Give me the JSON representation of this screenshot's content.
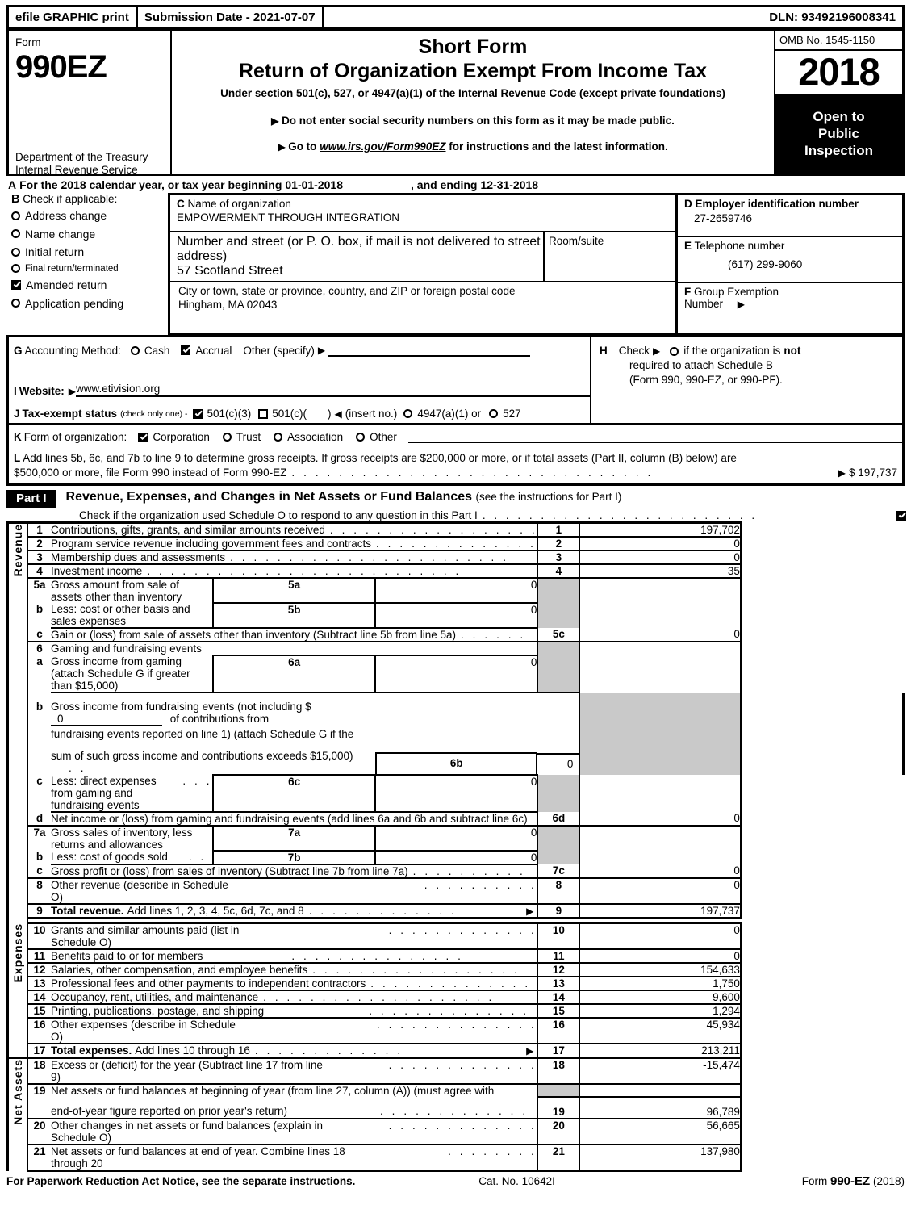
{
  "efile": {
    "graphic_print": "efile GRAPHIC print",
    "submission_date": "Submission Date - 2021-07-07",
    "dln": "DLN: 93492196008341"
  },
  "header": {
    "form_word": "Form",
    "form_number": "990EZ",
    "department": "Department of the Treasury Internal Revenue Service",
    "short_form": "Short Form",
    "title": "Return of Organization Exempt From Income Tax",
    "subtitle": "Under section 501(c), 527, or 4947(a)(1) of the Internal Revenue Code (except private foundations)",
    "bullet1": "Do not enter social security numbers on this form as it may be made public.",
    "bullet2_pre": "Go to",
    "bullet2_link": "www.irs.gov/Form990EZ",
    "bullet2_post": "for instructions and the latest information.",
    "omb": "OMB No. 1545-1150",
    "year": "2018",
    "open_to": "Open to",
    "public": "Public",
    "inspection": "Inspection"
  },
  "lineA": {
    "letter": "A",
    "text": "For the 2018 calendar year, or tax year beginning",
    "begin_date": "01-01-2018",
    "ending_label": ", and ending",
    "end_date": "12-31-2018"
  },
  "sectionB": {
    "letter": "B",
    "heading": "Check if applicable:",
    "items": [
      {
        "label": "Address change",
        "checked": false
      },
      {
        "label": "Name change",
        "checked": false
      },
      {
        "label": "Initial return",
        "checked": false
      },
      {
        "label": "Final return/terminated",
        "checked": false
      },
      {
        "label": "Amended return",
        "checked": true
      },
      {
        "label": "Application pending",
        "checked": false
      }
    ]
  },
  "sectionC": {
    "letter": "C",
    "name_label": "Name of organization",
    "org_name": "EMPOWERMENT THROUGH INTEGRATION",
    "street_label": "Number and street (or P. O. box, if mail is not delivered to street address)",
    "street": "57 Scotland Street",
    "room_label": "Room/suite",
    "room": "",
    "city_label": "City or town, state or province, country, and ZIP or foreign postal code",
    "city": "Hingham, MA   02043"
  },
  "sectionD": {
    "letter": "D",
    "ein_label": "Employer identification number",
    "ein": "27-2659746",
    "phone_letter": "E",
    "phone_label": "Telephone number",
    "phone": "(617) 299-9060",
    "group_letter": "F",
    "group_label1": "Group Exemption",
    "group_label2": "Number",
    "group_number": ""
  },
  "sectionG": {
    "letter": "G",
    "label": "Accounting Method:",
    "cash": "Cash",
    "cash_checked": false,
    "accrual": "Accrual",
    "accrual_checked": true,
    "other": "Other (specify)"
  },
  "sectionH": {
    "letter": "H",
    "line1a": "Check",
    "line1b": "if the organization is",
    "not_word": "not",
    "line2": "required to attach Schedule B",
    "line3": "(Form 990, 990-EZ, or 990-PF)."
  },
  "sectionI": {
    "letter": "I",
    "label": "Website:",
    "website": "www.etivision.org"
  },
  "sectionJ": {
    "letter": "J",
    "label": "Tax-exempt status",
    "note": "(check only one) -",
    "opt1": "501(c)(3)",
    "opt1_checked": true,
    "opt2": "501(c)(",
    "opt2_checked": false,
    "opt2_suffix": ")",
    "insert_no": "(insert no.)",
    "opt3": "4947(a)(1) or",
    "opt3_checked": false,
    "opt4": "527",
    "opt4_checked": false
  },
  "sectionK": {
    "letter": "K",
    "label": "Form of organization:",
    "options": [
      {
        "label": "Corporation",
        "checked": true
      },
      {
        "label": "Trust",
        "checked": false
      },
      {
        "label": "Association",
        "checked": false
      },
      {
        "label": "Other",
        "checked": false
      }
    ]
  },
  "sectionL": {
    "letter": "L",
    "text1": "Add lines 5b, 6c, and 7b to line 9 to determine gross receipts. If gross receipts are $200,000 or more, or if total assets (Part II, column (B) below) are",
    "text2": "$500,000 or more, file Form 990 instead of Form 990-EZ",
    "amount": "$ 197,737"
  },
  "partI": {
    "part_label": "Part I",
    "title": "Revenue, Expenses, and Changes in Net Assets or Fund Balances",
    "title_note": "(see the instructions for Part I)",
    "schedule_o": "Check if the organization used Schedule O to respond to any question in this Part I",
    "schedule_o_checked": true
  },
  "side_labels": {
    "revenue": "Revenue",
    "expenses": "Expenses",
    "net_assets": "Net Assets"
  },
  "revenue_lines": [
    {
      "n": "1",
      "desc": "Contributions, gifts, grants, and similar amounts received",
      "lnbox": "1",
      "amount": "197,702"
    },
    {
      "n": "2",
      "desc": "Program service revenue including government fees and contracts",
      "lnbox": "2",
      "amount": "0"
    },
    {
      "n": "3",
      "desc": "Membership dues and assessments",
      "lnbox": "3",
      "amount": "0"
    },
    {
      "n": "4",
      "desc": "Investment income",
      "lnbox": "4",
      "amount": "35"
    },
    {
      "n": "5a",
      "desc": "Gross amount from sale of assets other than inventory",
      "subbox": "5a",
      "subval": "0"
    },
    {
      "n": "b",
      "desc": "Less: cost or other basis and sales expenses",
      "subbox": "5b",
      "subval": "0"
    },
    {
      "n": "c",
      "desc": "Gain or (loss) from sale of assets other than inventory (Subtract line 5b from line 5a)",
      "lnbox": "5c",
      "amount": "0"
    },
    {
      "n": "6",
      "desc": "Gaming and fundraising events"
    },
    {
      "n": "a",
      "desc": "Gross income from gaming (attach Schedule G if greater than $15,000)",
      "subbox": "6a",
      "subval": "0"
    },
    {
      "n": "b",
      "desc_p1": "Gross income from fundraising events (not including $",
      "inline_value": "0",
      "desc_p2": "of contributions from",
      "desc_l2": "fundraising events reported on line 1) (attach Schedule G if the",
      "desc_l3": "sum of such gross income and contributions exceeds $15,000)",
      "subbox": "6b",
      "subval": "0"
    },
    {
      "n": "c",
      "desc": "Less: direct expenses from gaming and fundraising events",
      "subbox": "6c",
      "subval": "0"
    },
    {
      "n": "d",
      "desc": "Net income or (loss) from gaming and fundraising events (add lines 6a and 6b and subtract line 6c)",
      "lnbox": "6d",
      "amount": "0"
    },
    {
      "n": "7a",
      "desc": "Gross sales of inventory, less returns and allowances",
      "subbox": "7a",
      "subval": "0"
    },
    {
      "n": "b",
      "desc": "Less: cost of goods sold",
      "subbox": "7b",
      "subval": "0"
    },
    {
      "n": "c",
      "desc": "Gross profit or (loss) from sales of inventory (Subtract line 7b from line 7a)",
      "lnbox": "7c",
      "amount": "0"
    },
    {
      "n": "8",
      "desc": "Other revenue (describe in Schedule O)",
      "lnbox": "8",
      "amount": "0"
    },
    {
      "n": "9",
      "desc_bold": "Total revenue.",
      "desc": "Add lines 1, 2, 3, 4, 5c, 6d, 7c, and 8",
      "lnbox": "9",
      "amount": "197,737"
    }
  ],
  "expense_lines": [
    {
      "n": "10",
      "desc": "Grants and similar amounts paid (list in Schedule O)",
      "lnbox": "10",
      "amount": "0"
    },
    {
      "n": "11",
      "desc": "Benefits paid to or for members",
      "lnbox": "11",
      "amount": "0"
    },
    {
      "n": "12",
      "desc": "Salaries, other compensation, and employee benefits",
      "lnbox": "12",
      "amount": "154,633"
    },
    {
      "n": "13",
      "desc": "Professional fees and other payments to independent contractors",
      "lnbox": "13",
      "amount": "1,750"
    },
    {
      "n": "14",
      "desc": "Occupancy, rent, utilities, and maintenance",
      "lnbox": "14",
      "amount": "9,600"
    },
    {
      "n": "15",
      "desc": "Printing, publications, postage, and shipping",
      "lnbox": "15",
      "amount": "1,294"
    },
    {
      "n": "16",
      "desc": "Other expenses (describe in Schedule O)",
      "lnbox": "16",
      "amount": "45,934"
    },
    {
      "n": "17",
      "desc_bold": "Total expenses.",
      "desc": "Add lines 10 through 16",
      "lnbox": "17",
      "amount": "213,211"
    }
  ],
  "netasset_lines": [
    {
      "n": "18",
      "desc": "Excess or (deficit) for the year (Subtract line 17 from line 9)",
      "lnbox": "18",
      "amount": "-15,474"
    },
    {
      "n": "19",
      "desc_l1": "Net assets or fund balances at beginning of year (from line 27, column (A)) (must agree with",
      "desc_l2": "end-of-year figure reported on prior year's return)",
      "lnbox": "19",
      "amount": "96,789"
    },
    {
      "n": "20",
      "desc": "Other changes in net assets or fund balances (explain in Schedule O)",
      "lnbox": "20",
      "amount": "56,665"
    },
    {
      "n": "21",
      "desc": "Net assets or fund balances at end of year. Combine lines 18 through 20",
      "lnbox": "21",
      "amount": "137,980"
    }
  ],
  "footer": {
    "left": "For Paperwork Reduction Act Notice, see the separate instructions.",
    "center": "Cat. No. 10642I",
    "right_pre": "Form",
    "right_bold": "990-EZ",
    "right_post": "(2018)"
  }
}
